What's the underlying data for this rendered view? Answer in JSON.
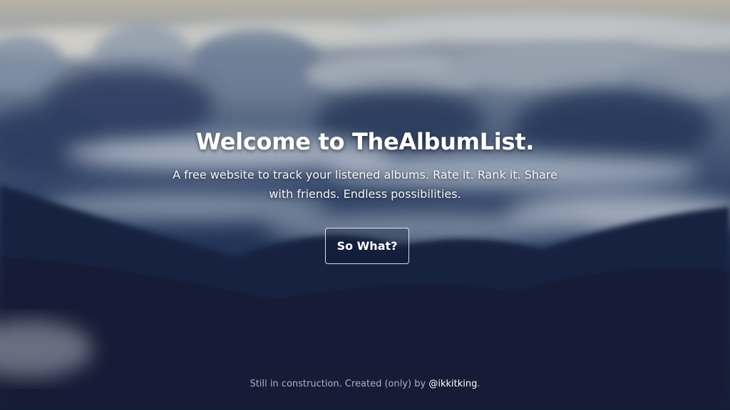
{
  "hero": {
    "title": "Welcome to TheAlbumList.",
    "subtitle": "A free website to track your listened albums. Rate it. Rank it. Share with friends. Endless possibilities.",
    "cta_label": "So What?"
  },
  "footer": {
    "text": "Still in construction. Created (only) by ",
    "author_handle": "@ikkitking",
    "trailing": "."
  },
  "colors": {
    "sky_top": "#b7b2a6",
    "cloud_mid": "#2f4266",
    "mountain_dark": "#121d36",
    "text_primary": "#ffffff",
    "footer_text": "#a9b1c0"
  }
}
